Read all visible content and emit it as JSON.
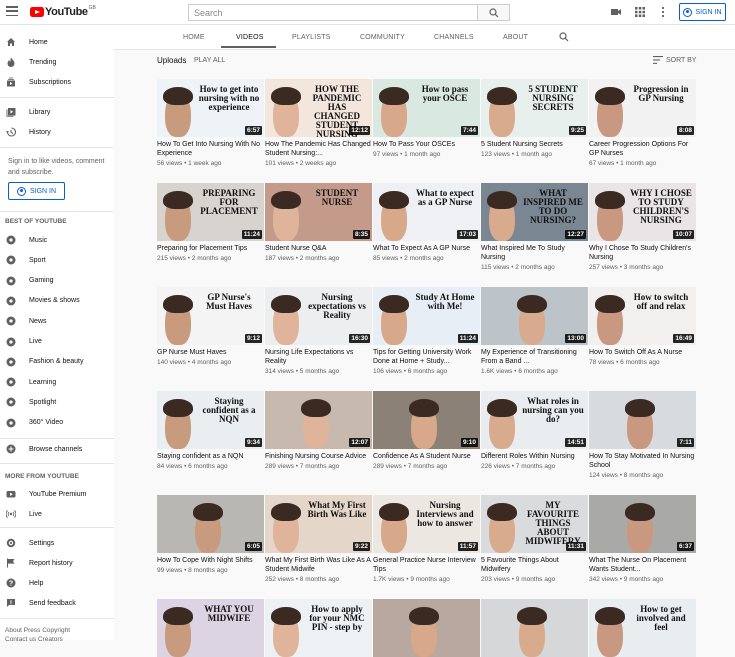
{
  "header": {
    "logo_text": "YouTube",
    "region": "GB",
    "search_placeholder": "Search",
    "signin_label": "SIGN IN"
  },
  "sidebar": {
    "main": [
      {
        "label": "Home",
        "icon": "home-icon"
      },
      {
        "label": "Trending",
        "icon": "flame-icon"
      },
      {
        "label": "Subscriptions",
        "icon": "subscriptions-icon"
      }
    ],
    "library": [
      {
        "label": "Library",
        "icon": "library-icon"
      },
      {
        "label": "History",
        "icon": "history-icon"
      }
    ],
    "signin_prompt": "Sign in to like videos, comment and subscribe.",
    "signin_label": "SIGN IN",
    "best_header": "BEST OF YOUTUBE",
    "best": [
      {
        "label": "Music"
      },
      {
        "label": "Sport"
      },
      {
        "label": "Gaming"
      },
      {
        "label": "Movies & shows"
      },
      {
        "label": "News"
      },
      {
        "label": "Live"
      },
      {
        "label": "Fashion & beauty"
      },
      {
        "label": "Learning"
      },
      {
        "label": "Spotlight"
      },
      {
        "label": "360° Video"
      }
    ],
    "browse": "Browse channels",
    "more_header": "MORE FROM YOUTUBE",
    "more": [
      {
        "label": "YouTube Premium"
      },
      {
        "label": "Live"
      }
    ],
    "settings": [
      {
        "label": "Settings"
      },
      {
        "label": "Report history"
      },
      {
        "label": "Help"
      },
      {
        "label": "Send feedback"
      }
    ],
    "footer_links": "About  Press  Copyright",
    "footer_links2": "Contact us  Creators"
  },
  "channel_tabs": [
    "HOME",
    "VIDEOS",
    "PLAYLISTS",
    "COMMUNITY",
    "CHANNELS",
    "ABOUT"
  ],
  "uploads": {
    "label": "Uploads",
    "play_all": "PLAY ALL",
    "sort_by": "SORT BY"
  },
  "videos": [
    {
      "title": "How To Get Into Nursing With No Experience",
      "meta": "56 views • 1 week ago",
      "duration": "6:57",
      "thumb_text": "How to get into nursing with no experience"
    },
    {
      "title": "How The Pandemic Has Changed Student Nursing:...",
      "meta": "101 views • 2 weeks ago",
      "duration": "12:12",
      "thumb_text": "HOW THE PANDEMIC HAS CHANGED STUDENT NURSING"
    },
    {
      "title": "How To Pass Your OSCEs",
      "meta": "97 views • 1 month ago",
      "duration": "7:44",
      "thumb_text": "How to pass your OSCE"
    },
    {
      "title": "5 Student Nursing Secrets",
      "meta": "123 views • 1 month ago",
      "duration": "9:25",
      "thumb_text": "5 STUDENT NURSING SECRETS"
    },
    {
      "title": "Career Progression Options For GP Nurses",
      "meta": "67 views • 1 month ago",
      "duration": "8:08",
      "thumb_text": "Progression in GP Nursing"
    },
    {
      "title": "Preparing for Placement Tips",
      "meta": "215 views • 2 months ago",
      "duration": "11:24",
      "thumb_text": "PREPARING FOR PLACEMENT"
    },
    {
      "title": "Student Nurse Q&A",
      "meta": "187 views • 2 months ago",
      "duration": "8:35",
      "thumb_text": "STUDENT NURSE"
    },
    {
      "title": "What To Expect As A GP Nurse",
      "meta": "85 views • 2 months ago",
      "duration": "17:03",
      "thumb_text": "What to expect as a GP Nurse"
    },
    {
      "title": "What Inspired Me To Study Nursing",
      "meta": "115 views • 2 months ago",
      "duration": "12:27",
      "thumb_text": "WHAT INSPIRED ME TO DO NURSING?"
    },
    {
      "title": "Why I Chose To Study Children's Nursing",
      "meta": "257 views • 3 months ago",
      "duration": "10:07",
      "thumb_text": "WHY I CHOSE TO STUDY CHILDREN'S NURSING"
    },
    {
      "title": "GP Nurse Must Haves",
      "meta": "140 views • 4 months ago",
      "duration": "9:12",
      "thumb_text": "GP Nurse's Must Haves"
    },
    {
      "title": "Nursing Life Expectations vs Reality",
      "meta": "314 views • 5 months ago",
      "duration": "16:30",
      "thumb_text": "Nursing expectations vs Reality"
    },
    {
      "title": "Tips for Getting University Work Done at Home + Study...",
      "meta": "106 views • 6 months ago",
      "duration": "11:24",
      "thumb_text": "Study At Home with Me!"
    },
    {
      "title": "My Experience of Transitioning From a Band ...",
      "meta": "1.6K views • 6 months ago",
      "duration": "13:00",
      "thumb_text": ""
    },
    {
      "title": "How To Switch Off As A Nurse",
      "meta": "78 views • 6 months ago",
      "duration": "16:49",
      "thumb_text": "How to switch off and relax"
    },
    {
      "title": "Staying confident as a NQN",
      "meta": "84 views • 6 months ago",
      "duration": "9:34",
      "thumb_text": "Staying confident as a NQN"
    },
    {
      "title": "Finishing Nursing Course Advice",
      "meta": "289 views • 7 months ago",
      "duration": "12:07",
      "thumb_text": ""
    },
    {
      "title": "Confidence As A Student Nurse",
      "meta": "289 views • 7 months ago",
      "duration": "9:10",
      "thumb_text": ""
    },
    {
      "title": "Different Roles Within Nursing",
      "meta": "226 views • 7 months ago",
      "duration": "14:51",
      "thumb_text": "What roles in nursing can you do?"
    },
    {
      "title": "How To Stay Motivated In Nursing School",
      "meta": "124 views • 8 months ago",
      "duration": "7:11",
      "thumb_text": ""
    },
    {
      "title": "How To Cope With Night Shifts",
      "meta": "99 views • 8 months ago",
      "duration": "6:05",
      "thumb_text": ""
    },
    {
      "title": "What My First Birth Was Like As A Student Midwife",
      "meta": "252 views • 8 months ago",
      "duration": "9:22",
      "thumb_text": "What My First Birth Was Like"
    },
    {
      "title": "General Practice Nurse Interview Tips",
      "meta": "1.7K views • 9 months ago",
      "duration": "11:57",
      "thumb_text": "Nursing Interviews and how to answer"
    },
    {
      "title": "5 Favourite Things About Midwifery",
      "meta": "203 views • 9 months ago",
      "duration": "11:31",
      "thumb_text": "MY FAVOURITE THINGS ABOUT MIDWIFERY"
    },
    {
      "title": "What The Nurse On Placement Wants Student...",
      "meta": "342 views • 9 months ago",
      "duration": "6:37",
      "thumb_text": ""
    },
    {
      "title": "",
      "meta": "",
      "duration": "",
      "thumb_text": "WHAT YOU MIDWIFE"
    },
    {
      "title": "",
      "meta": "",
      "duration": "",
      "thumb_text": "How to apply for your NMC PIN - step by"
    },
    {
      "title": "",
      "meta": "",
      "duration": "",
      "thumb_text": ""
    },
    {
      "title": "",
      "meta": "",
      "duration": "",
      "thumb_text": ""
    },
    {
      "title": "",
      "meta": "",
      "duration": "",
      "thumb_text": "How to get involved and feel"
    }
  ]
}
